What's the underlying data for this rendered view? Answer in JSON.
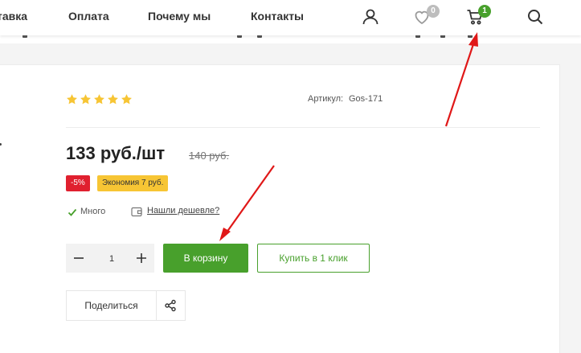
{
  "header": {
    "nav": [
      {
        "label": "тавка"
      },
      {
        "label": "Оплата"
      },
      {
        "label": "Почему мы"
      },
      {
        "label": "Контакты"
      }
    ],
    "favorites_count": "0",
    "cart_count": "1",
    "icons": [
      "user-icon",
      "heart-icon",
      "cart-icon",
      "search-icon"
    ]
  },
  "product": {
    "rating_stars": 5,
    "sku_label": "Артикул:",
    "sku_value": "Gos-171",
    "price": "133 руб./шт",
    "old_price": "140 руб.",
    "discount_tag": "-5%",
    "economy_tag": "Экономия 7 руб.",
    "stock": "Много",
    "cheaper_link": "Нашли дешевле?",
    "quantity": "1",
    "add_to_cart": "В корзину",
    "buy_one_click": "Купить в 1 клик",
    "share": "Поделиться"
  },
  "colors": {
    "accent_green": "#48a02c",
    "star_yellow": "#f7c534",
    "discount_red": "#e0202f",
    "badge_grey": "#bdbdbd",
    "annotation_red": "#e01818"
  }
}
